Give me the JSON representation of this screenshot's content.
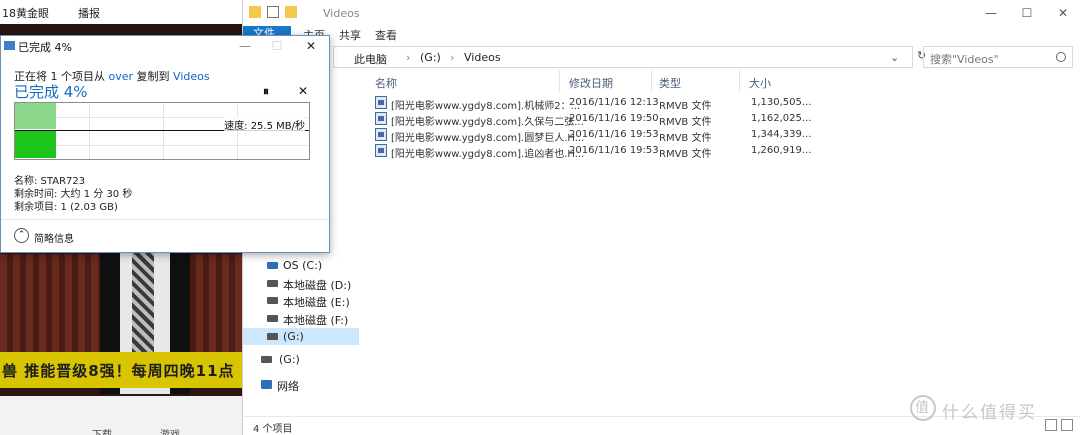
{
  "background_player": {
    "top_left_text": "18黄金眼",
    "top_menu_text": "播报",
    "ticker_text": "兽 推能晋级8强！每周四晚11点",
    "bottom_download": "下载",
    "bottom_games": "游戏"
  },
  "explorer": {
    "title": "Videos",
    "window_buttons": {
      "minimize": "—",
      "maximize": "☐",
      "close": "✕"
    },
    "ribbon_tabs": [
      "文件",
      "主页",
      "共享",
      "查看"
    ],
    "breadcrumb": [
      "此电脑",
      "(G:)",
      "Videos"
    ],
    "search_placeholder": "搜索\"Videos\"",
    "nav_items": [
      {
        "label": "OS (C:)",
        "selected": false
      },
      {
        "label": "本地磁盘 (D:)",
        "selected": false
      },
      {
        "label": "本地磁盘 (E:)",
        "selected": false
      },
      {
        "label": "本地磁盘 (F:)",
        "selected": false
      },
      {
        "label": "(G:)",
        "selected": true
      },
      {
        "label": "(G:)",
        "selected": false
      },
      {
        "label": "网络",
        "selected": false
      }
    ],
    "columns": {
      "name": "名称",
      "date": "修改日期",
      "type": "类型",
      "size": "大小"
    },
    "files": [
      {
        "name": "[阳光电影www.ygdy8.com].机械师2：...",
        "date": "2016/11/16 12:13",
        "type": "RMVB 文件",
        "size": "1,130,505..."
      },
      {
        "name": "[阳光电影www.ygdy8.com].久保与二弦...",
        "date": "2016/11/16 19:50",
        "type": "RMVB 文件",
        "size": "1,162,025..."
      },
      {
        "name": "[阳光电影www.ygdy8.com].圆梦巨人.H...",
        "date": "2016/11/16 19:53",
        "type": "RMVB 文件",
        "size": "1,344,339..."
      },
      {
        "name": "[阳光电影www.ygdy8.com].追凶者也.H...",
        "date": "2016/11/16 19:53",
        "type": "RMVB 文件",
        "size": "1,260,919..."
      }
    ],
    "status_text": "4 个项目"
  },
  "dialog": {
    "title": "已完成 4%",
    "copy_prefix": "正在将 1 个项目从 ",
    "copy_source": "over",
    "copy_middle": " 复制到 ",
    "copy_dest": "Videos",
    "percent_text": "已完成 4%",
    "pause_icon": "⏸",
    "cancel_icon": "✕",
    "progress_fraction": 0.04,
    "speed_text": "速度: 25.5 MB/秒",
    "name_line": "名称: STAR723",
    "time_line": "剩余时间: 大约 1 分 30 秒",
    "items_line": "剩余项目: 1 (2.03 GB)",
    "less_info": "简略信息"
  },
  "watermark": {
    "logo_glyph": "值",
    "text": "什么值得买"
  },
  "colors": {
    "accent": "#1979ca",
    "progress_light": "#8ed88e",
    "progress_dark": "#1cc41c",
    "link": "#1363c4"
  }
}
